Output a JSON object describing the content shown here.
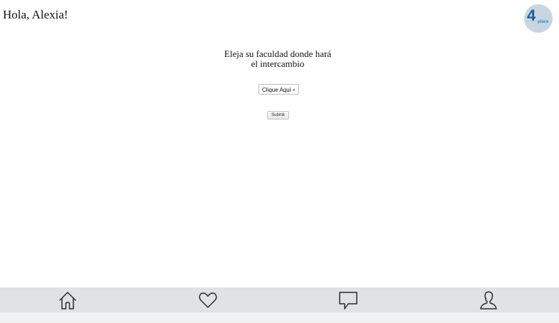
{
  "header": {
    "greeting": "Hola, Alexia!",
    "logo": {
      "number": "4",
      "word": "place",
      "icon": "4place-logo"
    }
  },
  "main": {
    "prompt_line1": "Eleja su faculdad donde hará",
    "prompt_line2": "el intercambio",
    "select": {
      "selected_value": "Clique Aqui",
      "arrow": "▾"
    },
    "submit_label": "Submit"
  },
  "navbar": {
    "items": [
      {
        "icon": "home-icon"
      },
      {
        "icon": "heart-icon"
      },
      {
        "icon": "chat-bubble-icon"
      },
      {
        "icon": "profile-icon"
      }
    ]
  },
  "colors": {
    "navbar_background": "#e0e2e3",
    "logo_background": "#c9d6df",
    "logo_number": "#1a5f9a",
    "logo_word": "#1a8fd0"
  }
}
